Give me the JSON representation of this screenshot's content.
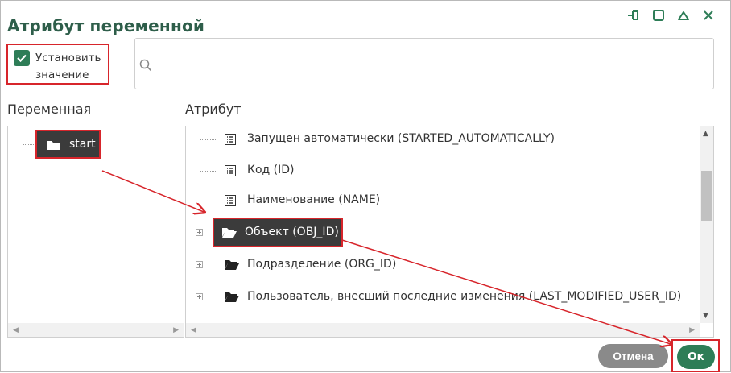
{
  "dialog": {
    "title": "Атрибут переменной",
    "window_icons": [
      "pin-icon",
      "maximize-icon",
      "collapse-icon",
      "close-icon"
    ]
  },
  "set_value": {
    "label": "Установить значение",
    "checked": true
  },
  "search": {
    "value": "",
    "placeholder": ""
  },
  "variables_panel": {
    "header": "Переменная",
    "items": [
      {
        "label": "start",
        "icon": "folder-icon",
        "selected": true
      }
    ]
  },
  "attributes_panel": {
    "header": "Атрибут",
    "items": [
      {
        "label": "Запущен автоматически (STARTED_AUTOMATICALLY)",
        "icon": "list-icon",
        "expandable": false
      },
      {
        "label": "Код (ID)",
        "icon": "list-icon",
        "expandable": false
      },
      {
        "label": "Наименование (NAME)",
        "icon": "list-icon",
        "expandable": false
      },
      {
        "label": "Объект (OBJ_ID)",
        "icon": "folder-open-icon",
        "expandable": true,
        "selected": true
      },
      {
        "label": "Подразделение (ORG_ID)",
        "icon": "folder-open-icon",
        "expandable": true
      },
      {
        "label": "Пользователь, внесший последние изменения (LAST_MODIFIED_USER_ID)",
        "icon": "folder-open-icon",
        "expandable": true
      }
    ]
  },
  "buttons": {
    "cancel": "Отмена",
    "ok": "Ок"
  },
  "colors": {
    "accent": "#2e7d57",
    "title": "#2e5e4a",
    "highlight": "#d7252b",
    "selection": "#3b3b3b"
  }
}
